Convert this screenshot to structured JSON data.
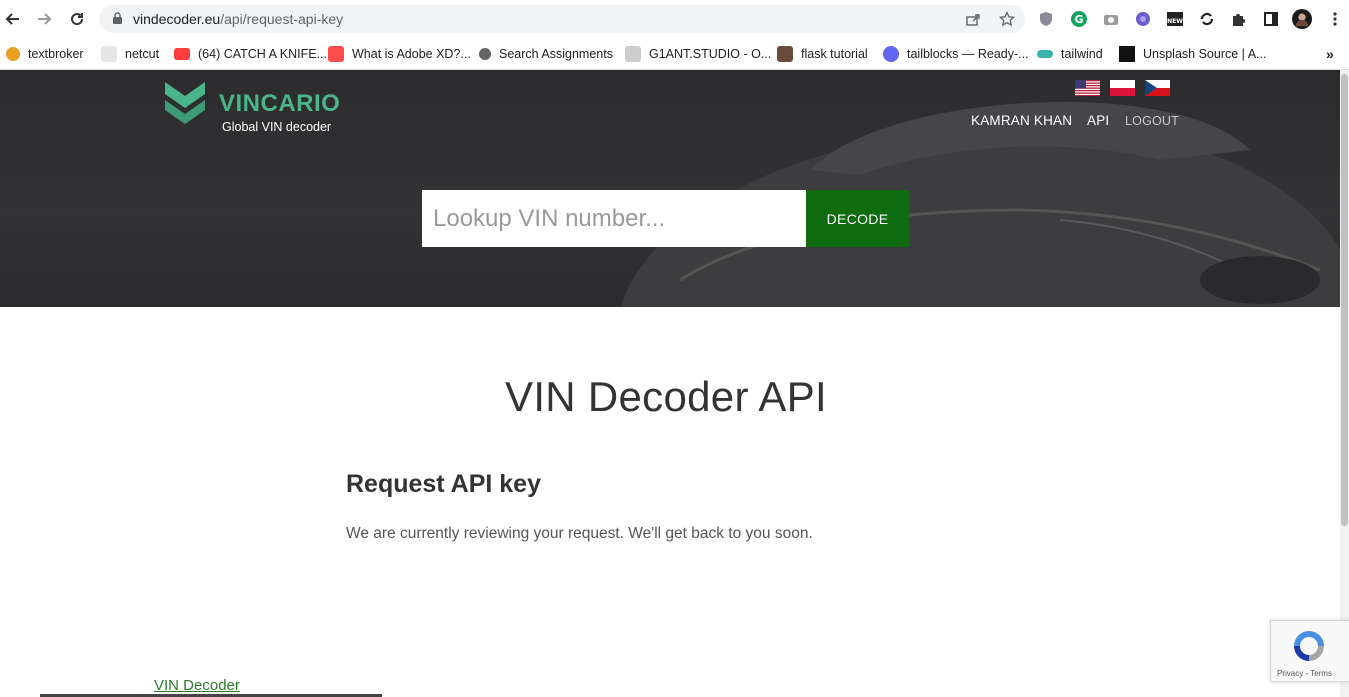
{
  "browser": {
    "url_host": "vindecoder.eu",
    "url_path": "/api/request-api-key"
  },
  "bookmarks": [
    {
      "label": "textbroker",
      "color": "#e8a020"
    },
    {
      "label": "netcut",
      "color": "#cfcfcf"
    },
    {
      "label": "(64) CATCH A KNIFE...",
      "color": "#ff3d3d"
    },
    {
      "label": "What is Adobe XD?...",
      "color": "#ff4b4b"
    },
    {
      "label": "Search Assignments",
      "color": "#555"
    },
    {
      "label": "G1ANT.STUDIO - O...",
      "color": "#bbb"
    },
    {
      "label": "flask tutorial",
      "color": "#6a4a3a"
    },
    {
      "label": "tailblocks — Ready-...",
      "color": "#6366f1"
    },
    {
      "label": "tailwind",
      "color": "#38b2ac"
    },
    {
      "label": "Unsplash Source | A...",
      "color": "#111"
    }
  ],
  "site": {
    "logo_text": "VINCARIO",
    "logo_sub": "Global VIN decoder",
    "nav": {
      "user": "KAMRAN KHAN",
      "api": "API",
      "logout": "LOGOUT"
    },
    "search": {
      "placeholder": "Lookup VIN number...",
      "button": "DECODE"
    }
  },
  "content": {
    "title": "VIN Decoder API",
    "section_title": "Request API key",
    "notice": "We are currently reviewing your request. We'll get back to you soon."
  },
  "footer": {
    "link": "VIN Decoder"
  },
  "recaptcha": {
    "text": "Privacy - Terms"
  },
  "colors": {
    "brand_green": "#4bb58a",
    "decode_button": "#0e6b0e"
  }
}
